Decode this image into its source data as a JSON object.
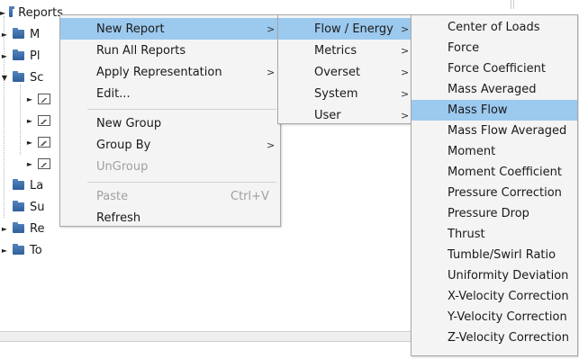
{
  "tree": {
    "items": [
      {
        "label": "Reports",
        "expander": "►",
        "kind": "folder"
      },
      {
        "label": "M",
        "expander": "►",
        "kind": "folder"
      },
      {
        "label": "Pl",
        "expander": "►",
        "kind": "folder"
      },
      {
        "label": "Sc",
        "expander": "▼",
        "kind": "folder"
      },
      {
        "label": "",
        "expander": "►",
        "kind": "report"
      },
      {
        "label": "",
        "expander": "►",
        "kind": "report"
      },
      {
        "label": "",
        "expander": "►",
        "kind": "report"
      },
      {
        "label": "",
        "expander": "►",
        "kind": "report"
      },
      {
        "label": "La",
        "expander": "",
        "kind": "folder"
      },
      {
        "label": "Su",
        "expander": "",
        "kind": "folder"
      },
      {
        "label": "Re",
        "expander": "►",
        "kind": "folder"
      },
      {
        "label": "To",
        "expander": "►",
        "kind": "folder"
      }
    ]
  },
  "context_menu": {
    "items": [
      {
        "label": "New Report",
        "submenu": true,
        "highlighted": true
      },
      {
        "label": "Run All Reports"
      },
      {
        "label": "Apply Representation",
        "submenu": true
      },
      {
        "label": "Edit..."
      },
      {
        "label": "New Group"
      },
      {
        "label": "Group By",
        "submenu": true
      },
      {
        "label": "UnGroup",
        "disabled": true
      },
      {
        "label": "Paste",
        "shortcut": "Ctrl+V",
        "disabled": true
      },
      {
        "label": "Refresh"
      }
    ],
    "arrow_glyph": ">"
  },
  "new_report_submenu": {
    "items": [
      {
        "label": "Flow / Energy",
        "highlighted": true
      },
      {
        "label": "Metrics"
      },
      {
        "label": "Overset"
      },
      {
        "label": "System"
      },
      {
        "label": "User"
      }
    ]
  },
  "flow_energy_submenu": {
    "items": [
      {
        "label": "Center of Loads"
      },
      {
        "label": "Force"
      },
      {
        "label": "Force Coefficient"
      },
      {
        "label": "Mass Averaged"
      },
      {
        "label": "Mass Flow",
        "highlighted": true
      },
      {
        "label": "Mass Flow Averaged"
      },
      {
        "label": "Moment"
      },
      {
        "label": "Moment Coefficient"
      },
      {
        "label": "Pressure Correction"
      },
      {
        "label": "Pressure Drop"
      },
      {
        "label": "Thrust"
      },
      {
        "label": "Tumble/Swirl Ratio"
      },
      {
        "label": "Uniformity Deviation"
      },
      {
        "label": "X-Velocity Correction"
      },
      {
        "label": "Y-Velocity Correction"
      },
      {
        "label": "Z-Velocity Correction"
      }
    ]
  },
  "colors": {
    "highlight": "#9cc9ee",
    "menu_background": "#f4f4f4",
    "folder_icon": "#3a6ea8",
    "disabled_text": "#a0a0a0"
  }
}
